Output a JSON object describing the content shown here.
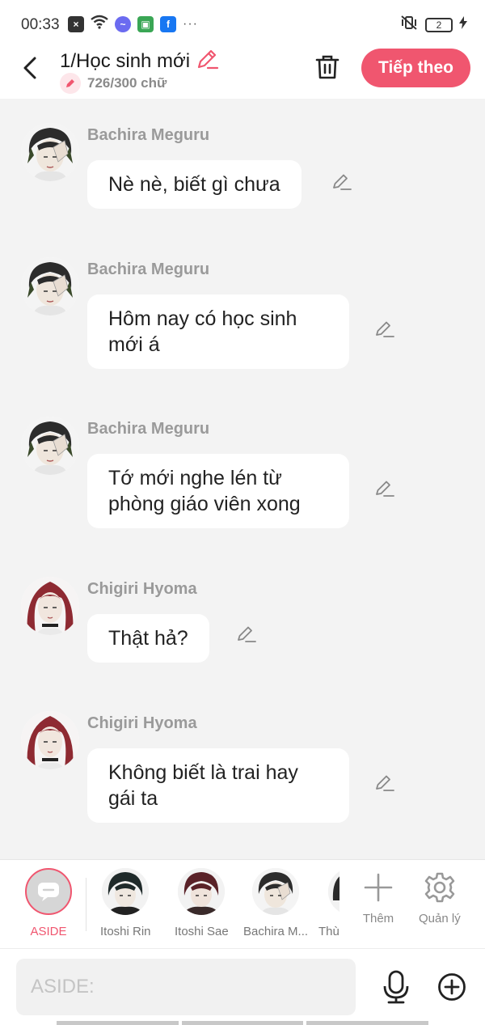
{
  "status_bar": {
    "time": "00:33",
    "battery": "2",
    "more": "···"
  },
  "header": {
    "title": "1/Học sinh mới",
    "word_count": "726/300 chữ",
    "next_button": "Tiếp theo",
    "accent_color": "#f0566f"
  },
  "messages": [
    {
      "sender": "Bachira Meguru",
      "lines": [
        "Nè nè, biết gì chưa"
      ],
      "avatar": "bachira"
    },
    {
      "sender": "Bachira Meguru",
      "lines": [
        "Hôm nay có học sinh",
        "mới á"
      ],
      "avatar": "bachira"
    },
    {
      "sender": "Bachira Meguru",
      "lines": [
        "Tớ mới nghe lén từ",
        "phòng giáo viên xong"
      ],
      "avatar": "bachira"
    },
    {
      "sender": "Chigiri Hyoma",
      "lines": [
        "Thật hả?"
      ],
      "avatar": "chigiri"
    },
    {
      "sender": "Chigiri Hyoma",
      "lines": [
        "Không biết là trai hay",
        "gái ta"
      ],
      "avatar": "chigiri"
    }
  ],
  "character_bar": {
    "items": [
      {
        "label": "ASIDE"
      },
      {
        "label": "Itoshi Rin"
      },
      {
        "label": "Itoshi Sae"
      },
      {
        "label": "Bachira M..."
      },
      {
        "label": "Thù"
      }
    ],
    "add_label": "Thêm",
    "manage_label": "Quản lý"
  },
  "input": {
    "placeholder": "ASIDE:"
  }
}
